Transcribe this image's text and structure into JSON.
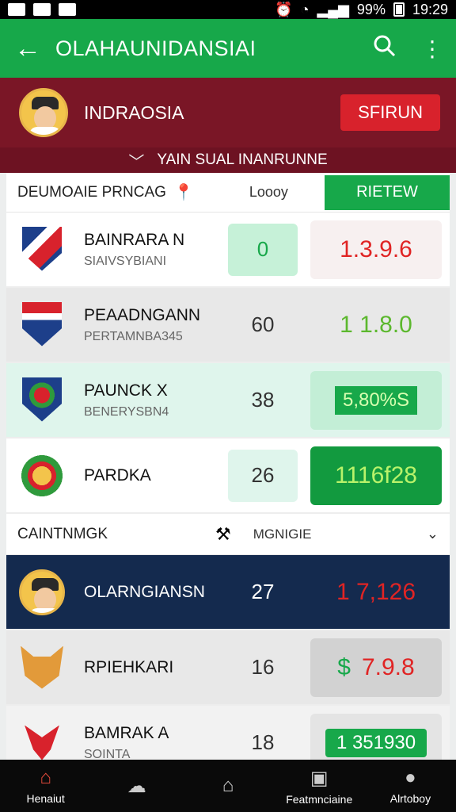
{
  "status": {
    "battery": "99%",
    "time": "19:29"
  },
  "appbar": {
    "title": "OLAHAUNIDANSIAI"
  },
  "banner": {
    "name": "INDRAOSIA",
    "return_label": "SFIRUN"
  },
  "subbanner": {
    "text": "YAIN SUAL INANRUNNE"
  },
  "card": {
    "title": "DEUMOAIE PRNCAG",
    "loop_label": "Loooy",
    "review_label": "RIETEW"
  },
  "teams": [
    {
      "name": "BAINRARA N",
      "sub": "SIAIVSYBIANI",
      "num": "0",
      "value": "1.3.9.6",
      "value_color": "#e02424"
    },
    {
      "name": "PEAADNGANN",
      "sub": "PERTAMNBA345",
      "num": "60",
      "value": "1 1.8.0",
      "value_color": "#5cb82e"
    },
    {
      "name": "PAUNCK X",
      "sub": "BENERYSBN4",
      "num": "38",
      "value": "5,80%S",
      "value_color": "#ffffff"
    },
    {
      "name": "PARDKA",
      "sub": "",
      "num": "26",
      "value": "1116f28",
      "value_color": "#b9f36a"
    }
  ],
  "section": {
    "title": "CAINTNMGK",
    "sort_label": "MGNIGIE"
  },
  "players": [
    {
      "name": "OLARNGIANSN",
      "sub": "",
      "num": "27",
      "value": "1 7,126",
      "value_color": "#e02424"
    },
    {
      "name": "RPIEHKARI",
      "sub": "",
      "num": "16",
      "value_prefix": "$",
      "value": "7.9.8",
      "value_color": "#e02424"
    },
    {
      "name": "BAMRAK A",
      "sub": "SOINTA",
      "num": "18",
      "value": "1 351930",
      "value_color": "#ffffff"
    }
  ],
  "nav": [
    {
      "label": "Henaiut",
      "icon": "home-icon"
    },
    {
      "label": "",
      "icon": "refresh-cloud-icon"
    },
    {
      "label": "",
      "icon": "house-outline-icon"
    },
    {
      "label": "Featmnciaine",
      "icon": "card-icon"
    },
    {
      "label": "Alrtoboy",
      "icon": "profile-icon"
    }
  ]
}
